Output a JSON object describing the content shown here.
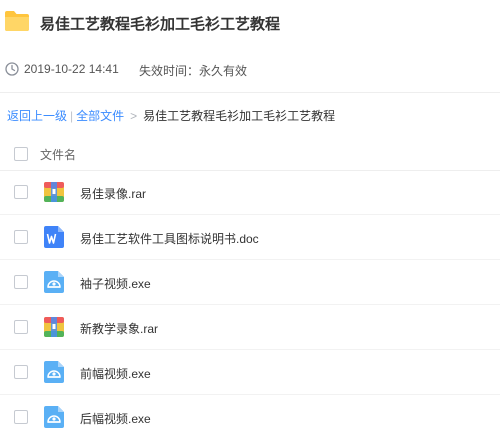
{
  "folder": {
    "title": "易佳工艺教程毛衫加工毛衫工艺教程",
    "date": "2019-10-22 14:41",
    "expire": "失效时间：永久有效"
  },
  "breadcrumb": {
    "back": "返回上一级",
    "separator": "|",
    "all_files": "全部文件",
    "arrow": ">",
    "current": "易佳工艺教程毛衫加工毛衫工艺教程"
  },
  "list": {
    "column_name": "文件名",
    "files": [
      {
        "name": "易佳录像.rar",
        "icon": "rar-archive-icon"
      },
      {
        "name": "易佳工艺软件工具图标说明书.doc",
        "icon": "word-doc-icon"
      },
      {
        "name": "袖子视频.exe",
        "icon": "exe-file-icon"
      },
      {
        "name": "新教学录象.rar",
        "icon": "rar-archive-icon"
      },
      {
        "name": "前幅视频.exe",
        "icon": "exe-file-icon"
      },
      {
        "name": "后幅视频.exe",
        "icon": "exe-file-icon"
      }
    ]
  },
  "colors": {
    "link": "#3b8cff",
    "folder": "#ffc53d",
    "word": "#3f83f8",
    "exe": "#5ab0f5"
  }
}
